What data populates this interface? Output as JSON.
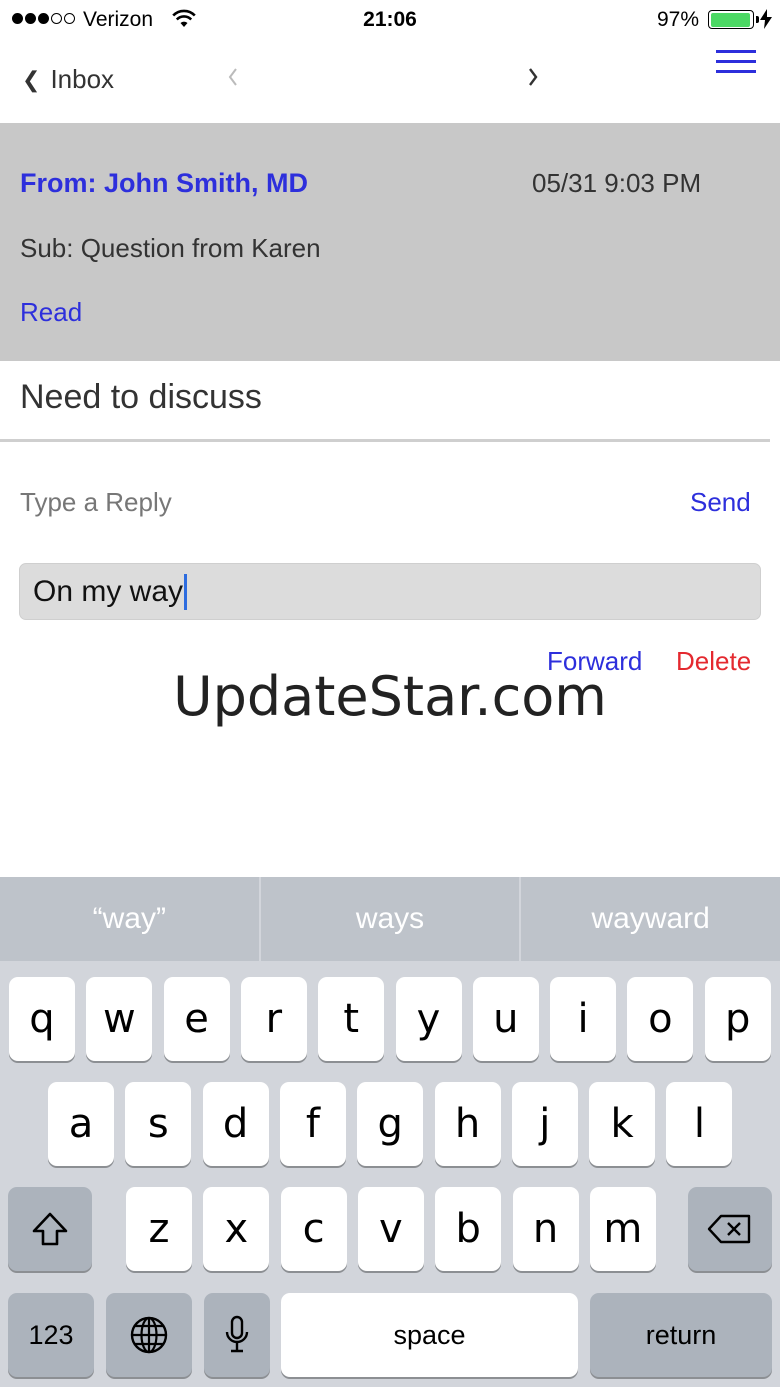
{
  "status_bar": {
    "carrier": "Verizon",
    "time": "21:06",
    "battery_percent": "97%",
    "battery_level": 0.97,
    "signal_bars_filled": 3,
    "signal_bars_total": 5
  },
  "nav": {
    "back_label": "Inbox",
    "back_icon": "chevron-left-icon",
    "prev_icon": "chevron-left-icon",
    "next_icon": "chevron-right-icon",
    "menu_icon": "hamburger-menu-icon"
  },
  "message": {
    "from": "From: John Smith, MD",
    "date": "05/31 9:03 PM",
    "subject": "Sub: Question from Karen",
    "status": "Read",
    "body": "Need to discuss"
  },
  "reply": {
    "label": "Type a Reply",
    "send_label": "Send",
    "value": "On my way",
    "forward_label": "Forward",
    "delete_label": "Delete"
  },
  "watermark": "UpdateStar.com",
  "keyboard": {
    "suggestions": [
      "“way”",
      "ways",
      "wayward"
    ],
    "row1": [
      "q",
      "w",
      "e",
      "r",
      "t",
      "y",
      "u",
      "i",
      "o",
      "p"
    ],
    "row2": [
      "a",
      "s",
      "d",
      "f",
      "g",
      "h",
      "j",
      "k",
      "l"
    ],
    "row3": [
      "z",
      "x",
      "c",
      "v",
      "b",
      "n",
      "m"
    ],
    "numbers_label": "123",
    "space_label": "space",
    "return_label": "return",
    "shift_icon": "shift-icon",
    "delete_icon": "backspace-icon",
    "globe_icon": "globe-icon",
    "mic_icon": "microphone-icon"
  },
  "colors": {
    "accent": "#2d2fdc",
    "danger": "#e4292f",
    "header_bg": "#c8c8c8",
    "battery": "#4cd964"
  }
}
